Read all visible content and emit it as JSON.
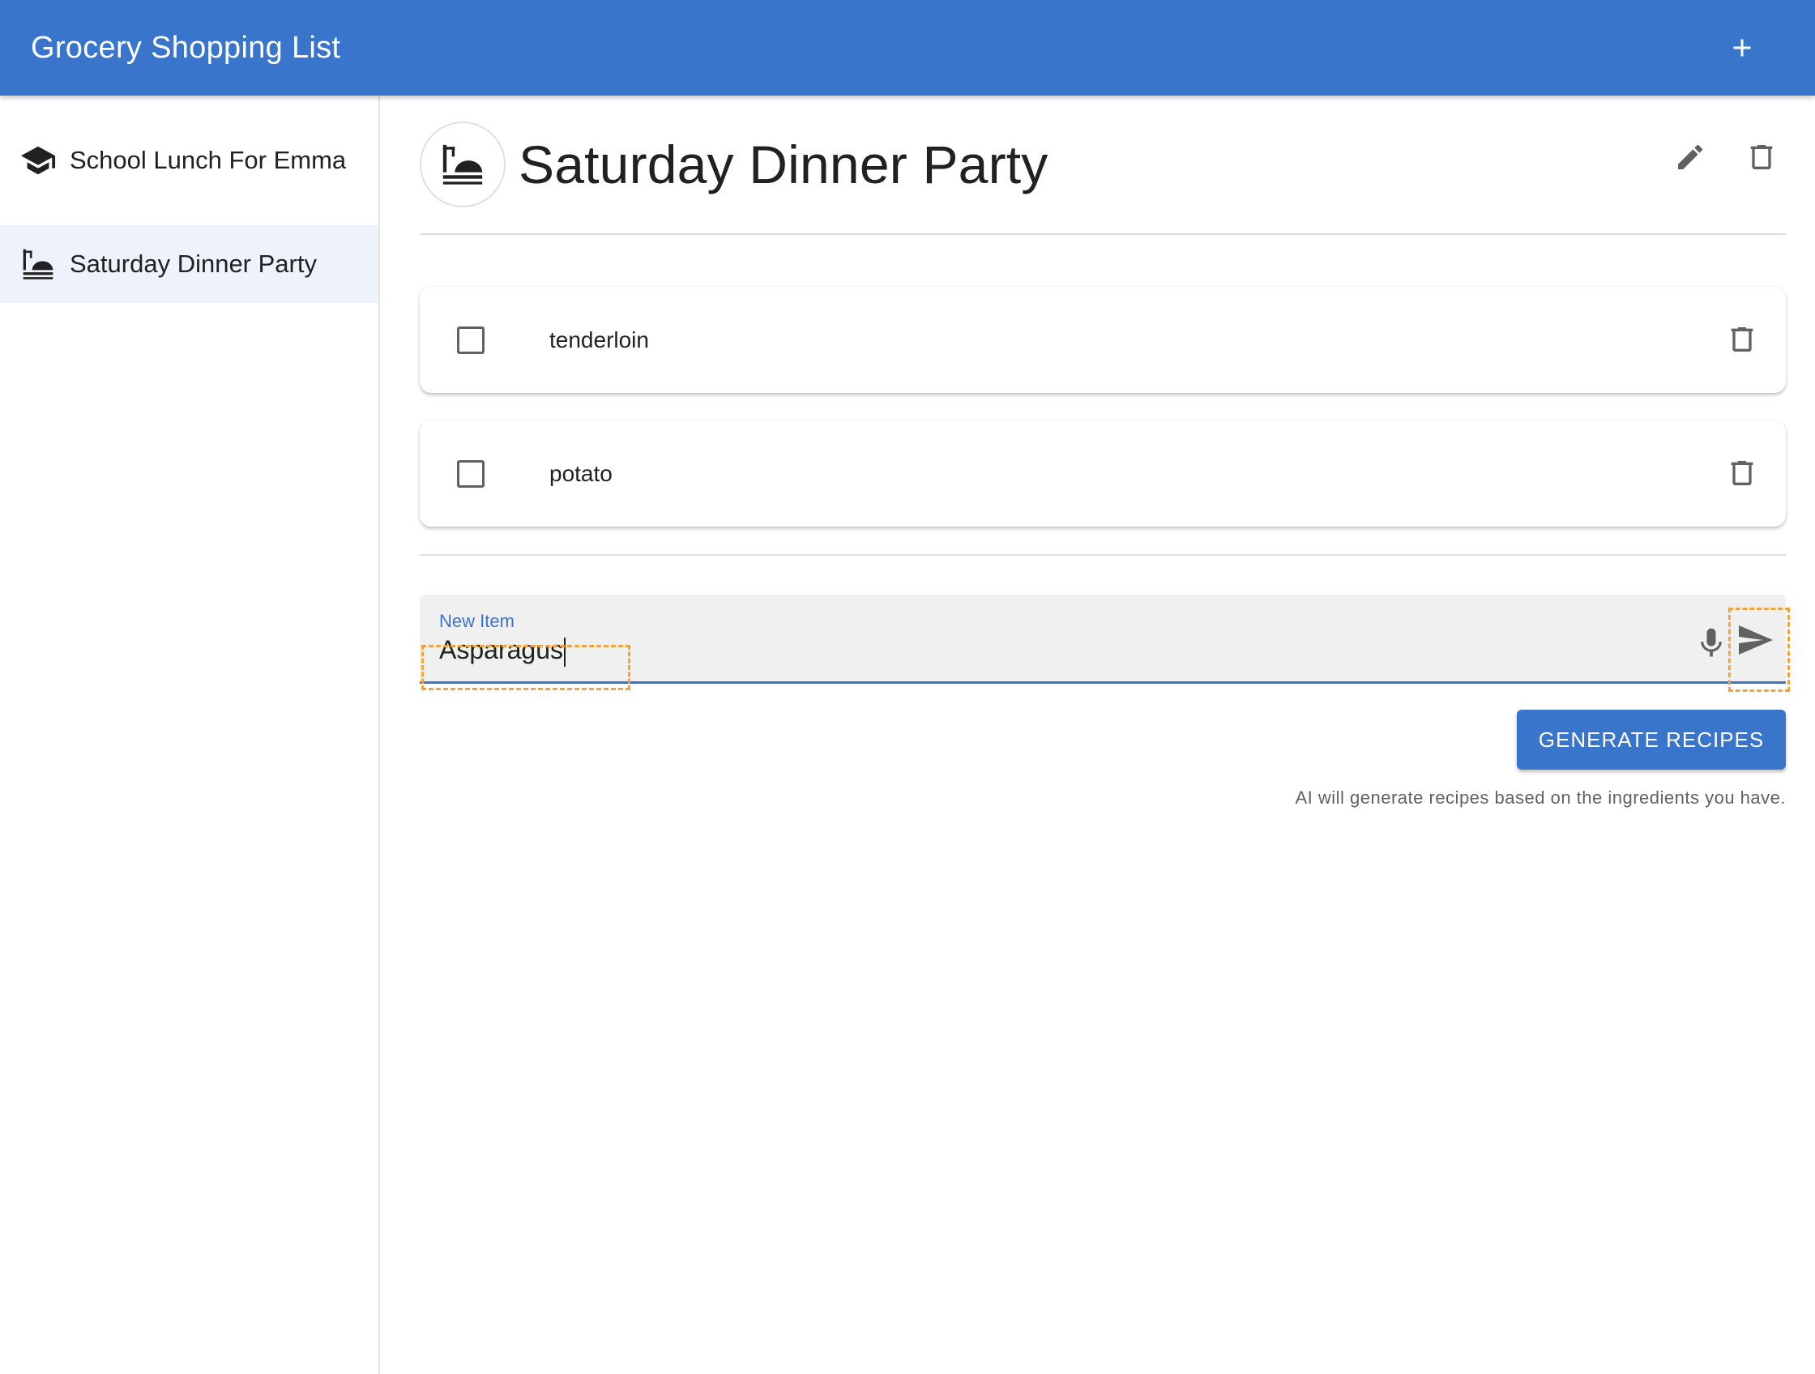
{
  "app": {
    "title": "Grocery Shopping List",
    "add_icon": "plus-icon"
  },
  "sidebar": {
    "items": [
      {
        "label": "School Lunch For Emma",
        "icon": "graduation-cap-icon",
        "active": false
      },
      {
        "label": "Saturday Dinner Party",
        "icon": "dinner-table-icon",
        "active": true
      }
    ]
  },
  "list": {
    "title": "Saturday Dinner Party",
    "icon": "dinner-table-icon",
    "actions": [
      "edit-icon",
      "delete-icon"
    ],
    "items": [
      {
        "label": "tenderloin",
        "checked": false
      },
      {
        "label": "potato",
        "checked": false
      }
    ]
  },
  "new_item": {
    "label": "New Item",
    "value": "Asparagus"
  },
  "generate": {
    "button_label": "GENERATE RECIPES",
    "hint": "AI will generate recipes based on the ingredients you have."
  },
  "colors": {
    "primary": "#3a75cc",
    "highlight": "#f2a33a",
    "active_bg": "#eef3fb"
  }
}
